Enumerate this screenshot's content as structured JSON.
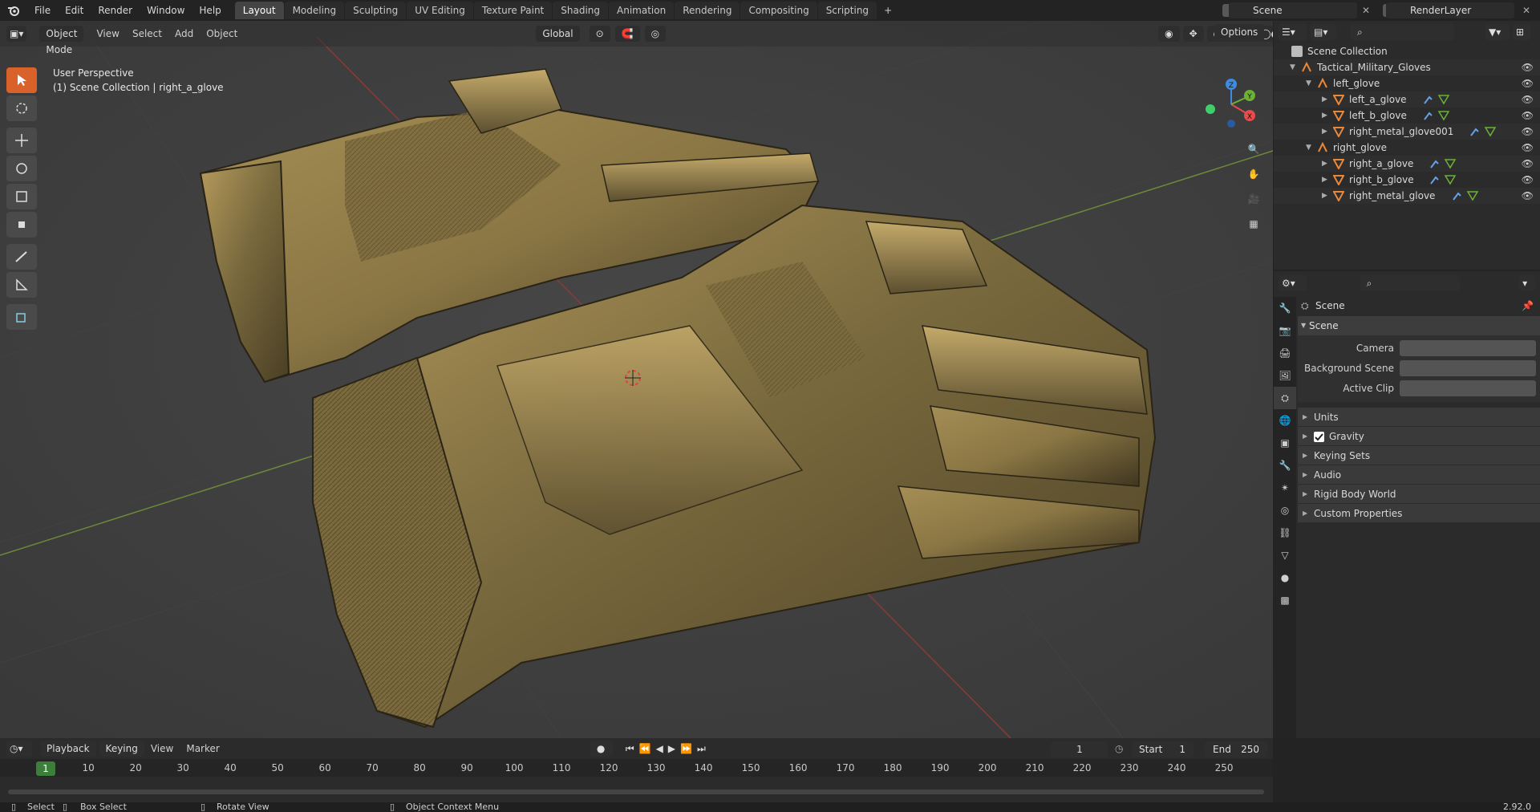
{
  "topbar": {
    "menus": [
      "File",
      "Edit",
      "Render",
      "Window",
      "Help"
    ],
    "workspaces": [
      "Layout",
      "Modeling",
      "Sculpting",
      "UV Editing",
      "Texture Paint",
      "Shading",
      "Animation",
      "Rendering",
      "Compositing",
      "Scripting"
    ],
    "active_workspace": "Layout",
    "add_tab": "+",
    "scene_name": "Scene",
    "view_layer": "RenderLayer"
  },
  "viewport": {
    "mode": "Object Mode",
    "menus": [
      "View",
      "Select",
      "Add",
      "Object"
    ],
    "transform_orientation": "Global",
    "options_label": "Options",
    "view_name": "User Perspective",
    "active_info": "(1) Scene Collection | right_a_glove",
    "gizmo_axes": {
      "x": "X",
      "y": "Y",
      "z": "Z"
    }
  },
  "outliner": {
    "root": "Scene Collection",
    "rows": [
      {
        "label": "Tactical_Military_Gloves",
        "depth": 1,
        "type": "empty"
      },
      {
        "label": "left_glove",
        "depth": 2,
        "type": "empty"
      },
      {
        "label": "left_a_glove",
        "depth": 3,
        "type": "mesh"
      },
      {
        "label": "left_b_glove",
        "depth": 3,
        "type": "mesh"
      },
      {
        "label": "right_metal_glove001",
        "depth": 3,
        "type": "mesh"
      },
      {
        "label": "right_glove",
        "depth": 2,
        "type": "empty"
      },
      {
        "label": "right_a_glove",
        "depth": 3,
        "type": "mesh"
      },
      {
        "label": "right_b_glove",
        "depth": 3,
        "type": "mesh"
      },
      {
        "label": "right_metal_glove",
        "depth": 3,
        "type": "mesh"
      }
    ]
  },
  "properties": {
    "context": "Scene",
    "panel": "Scene",
    "fields": [
      {
        "label": "Camera"
      },
      {
        "label": "Background Scene"
      },
      {
        "label": "Active Clip"
      }
    ],
    "subpanels": [
      {
        "label": "Units"
      },
      {
        "label": "Gravity",
        "checkbox": true
      },
      {
        "label": "Keying Sets"
      },
      {
        "label": "Audio"
      },
      {
        "label": "Rigid Body World"
      },
      {
        "label": "Custom Properties"
      }
    ]
  },
  "timeline": {
    "menus": [
      "Playback",
      "Keying",
      "View",
      "Marker"
    ],
    "current_frame": "1",
    "start_label": "Start",
    "start": "1",
    "end_label": "End",
    "end": "250",
    "ticks": [
      "10",
      "20",
      "30",
      "40",
      "50",
      "60",
      "70",
      "80",
      "90",
      "100",
      "110",
      "120",
      "130",
      "140",
      "150",
      "160",
      "170",
      "180",
      "190",
      "200",
      "210",
      "220",
      "230",
      "240",
      "250"
    ]
  },
  "statusbar": {
    "select": "Select",
    "box_select": "Box Select",
    "rotate_view": "Rotate View",
    "context_menu": "Object Context Menu",
    "version": "2.92.0"
  },
  "colors": {
    "accent": "#d9622b",
    "active_tab": "#444444",
    "frame": "#3b7f3b",
    "mesh_icon": "#e8883a",
    "axis_x": "#e84b4b",
    "axis_y": "#6bb234",
    "axis_z": "#3f8be0"
  }
}
